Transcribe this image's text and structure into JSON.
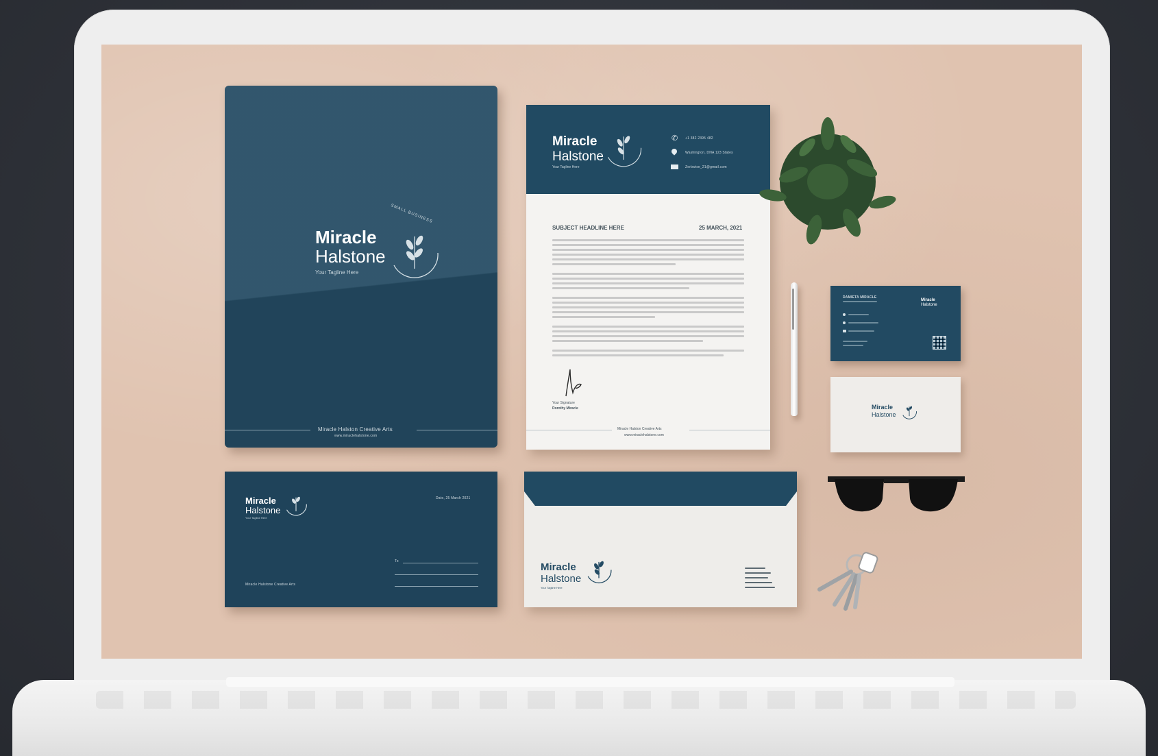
{
  "brand": {
    "word1": "Miracle",
    "word2": "Halstone",
    "tagline": "Your Tagline Here",
    "arc_text": "SMALL BUSINESS"
  },
  "folder": {
    "footer_name": "Miracle Halston Creative Arts",
    "footer_url": "www.miraclehalstone.com"
  },
  "letterhead": {
    "contact_phone": "+1 382 2395 482",
    "contact_address": "Washington, DNA 123 States",
    "contact_email": "Zerbwise_21@gmail.com",
    "subject": "SUBJECT HEADLINE HERE",
    "date": "25 MARCH, 2021",
    "signature_label": "Your Signature",
    "signature_name": "Dorothy Miracle",
    "footer_name": "Miracle Halston Creative Arts",
    "footer_url": "www.miraclehalstone.com"
  },
  "envelope_navy": {
    "date": "Date, 25 March 2021",
    "to_label": "To",
    "footer_name": "Miracle Halstone Creative Arts"
  },
  "business_card": {
    "name": "DAMIETA MIRACLE"
  },
  "colors": {
    "navy": "#1f435a",
    "paper": "#f4f3f1",
    "background_surface": "#e0c3b0",
    "laptop": "#eeeeee",
    "backdrop": "#2e3138"
  }
}
